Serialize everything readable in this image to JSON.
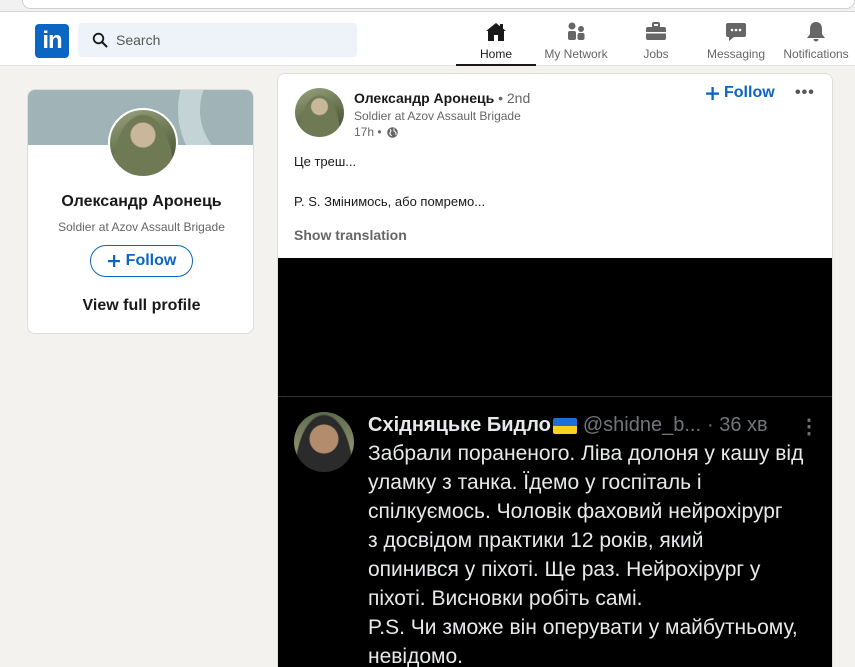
{
  "nav": {
    "search_placeholder": "Search",
    "items": [
      {
        "label": "Home"
      },
      {
        "label": "My Network"
      },
      {
        "label": "Jobs"
      },
      {
        "label": "Messaging"
      },
      {
        "label": "Notifications"
      }
    ]
  },
  "profile_card": {
    "name": "Олександр Аронець",
    "headline": "Soldier at Azov Assault Brigade",
    "follow_label": "Follow",
    "view_profile_label": "View full profile"
  },
  "post": {
    "author": "Олександр Аронець",
    "degree": "• 2nd",
    "headline": "Soldier at Azov Assault Brigade",
    "time": "17h •",
    "follow_label": "Follow",
    "more_label": "•••",
    "text_line1": "Це треш...",
    "text_line2": "P. S. Змінимось, або помремо...",
    "show_translation": "Show translation"
  },
  "tweet": {
    "name": "Східняцьке Бидло",
    "handle": "@shidne_b...",
    "time": "· 36 хв",
    "more": "⋮",
    "lines": [
      "Забрали пораненого. Ліва долоня у кашу від",
      "уламку з танка. Їдемо у госпіталь і",
      "спілкуємось. Чоловік фаховий нейрохірург",
      "з досвідом практики 12 років, який",
      "опинився у піхоті. Ще раз. Нейрохірург у",
      "піхоті. Висновки робіть самі.",
      "P.S. Чи зможе він оперувати у майбутньому,",
      "невідомо."
    ]
  },
  "colors": {
    "brand": "#0a66c2",
    "page_bg": "#f4f2ee",
    "media_bg": "#000000"
  }
}
